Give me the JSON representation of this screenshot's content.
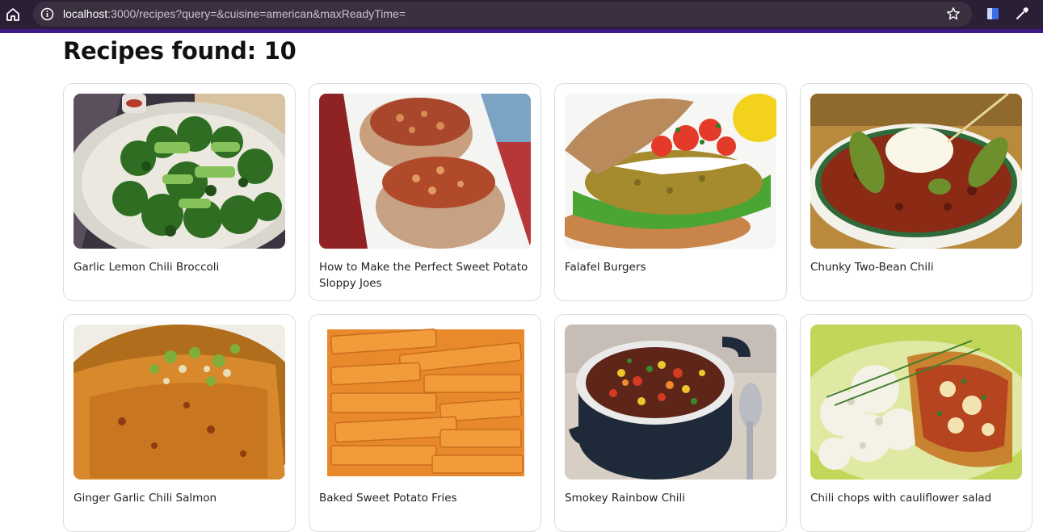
{
  "browser": {
    "url_host": "localhost",
    "url_rest": ":3000/recipes?query=&cuisine=american&maxReadyTime=",
    "icons": [
      "home-icon",
      "info-icon",
      "star-icon",
      "extension-icon",
      "eyedropper-icon"
    ]
  },
  "page": {
    "heading": "Recipes found: 10"
  },
  "recipes": [
    {
      "title": "Garlic Lemon Chili Broccoli"
    },
    {
      "title": "How to Make the Perfect Sweet Potato Sloppy Joes"
    },
    {
      "title": "Falafel Burgers"
    },
    {
      "title": "Chunky Two-Bean Chili"
    },
    {
      "title": "Ginger Garlic Chili Salmon"
    },
    {
      "title": "Baked Sweet Potato Fries"
    },
    {
      "title": "Smokey Rainbow Chili"
    },
    {
      "title": "Chili chops with cauliflower salad"
    }
  ],
  "colors": {
    "chrome_bg": "#2b1f35",
    "chrome_accent": "#3d1a86",
    "card_border": "#dcdcdc"
  }
}
